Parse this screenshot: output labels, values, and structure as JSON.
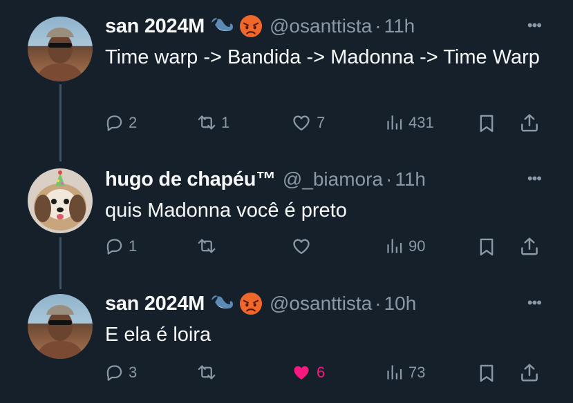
{
  "tweets": [
    {
      "name": "san 2024M",
      "handle": "@osanttista",
      "time": "11h",
      "text": "Time warp -> Bandida -> Madonna -> Time Warp",
      "replies": "2",
      "retweets": "1",
      "likes": "7",
      "views": "431",
      "liked": false
    },
    {
      "name": "hugo de chapéu™",
      "handle": "@_biamora",
      "time": "11h",
      "text": "quis Madonna você é preto",
      "replies": "1",
      "retweets": "",
      "likes": "",
      "views": "90",
      "liked": false
    },
    {
      "name": "san 2024M",
      "handle": "@osanttista",
      "time": "10h",
      "text": "E ela é loira",
      "replies": "3",
      "retweets": "",
      "likes": "6",
      "views": "73",
      "liked": true
    }
  ],
  "separator": "·",
  "more_label": "•••",
  "colors": {
    "background": "#15202b",
    "muted": "#8b98a5",
    "like_pink": "#f91880",
    "thread_line": "#3e5264"
  },
  "icons": [
    "whale-emoji-icon",
    "angry-face-emoji-icon",
    "reply-icon",
    "retweet-icon",
    "heart-icon",
    "views-icon",
    "bookmark-icon",
    "share-icon",
    "more-icon"
  ]
}
